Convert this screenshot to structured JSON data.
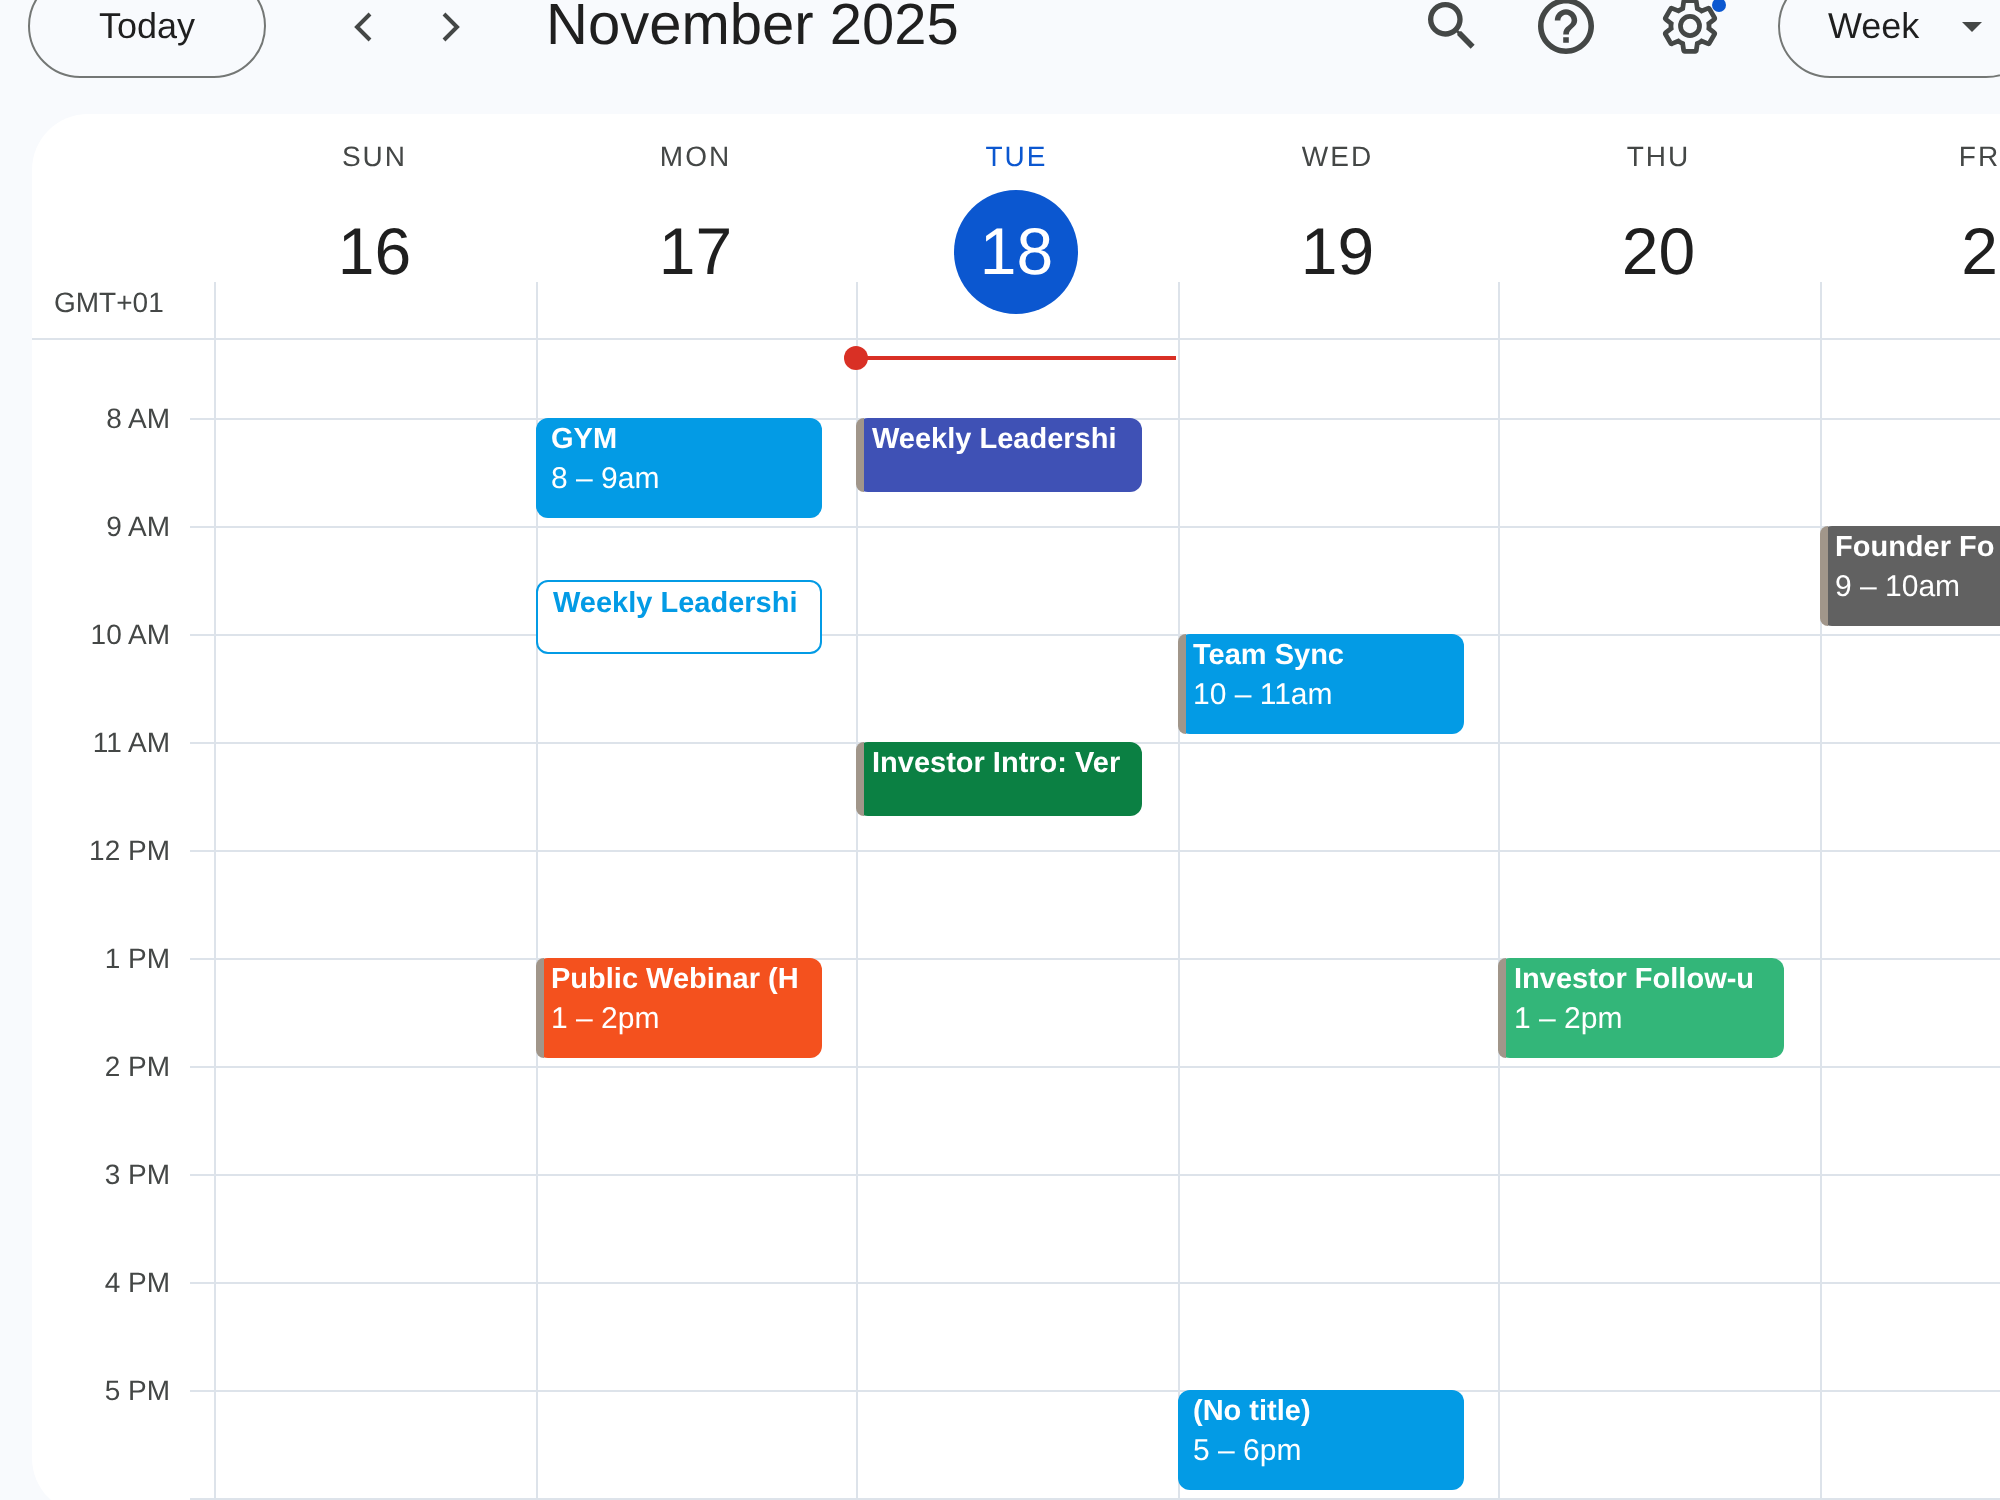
{
  "toolbar": {
    "today_button": "Today",
    "title": "November 2025",
    "view": "Week",
    "settings_notification": true
  },
  "timezone": "GMT+01",
  "hours": [
    "8 AM",
    "9 AM",
    "10 AM",
    "11 AM",
    "12 PM",
    "1 PM",
    "2 PM",
    "3 PM",
    "4 PM",
    "5 PM"
  ],
  "days": [
    {
      "weekday": "SUN",
      "date": "16",
      "today": false
    },
    {
      "weekday": "MON",
      "date": "17",
      "today": false,
      "events": [
        {
          "title": "GYM",
          "time": "8 – 9am",
          "color": "#039be5",
          "kind": "filled",
          "stripe": false
        },
        {
          "title": "Weekly Leadershi",
          "color": "#039be5",
          "kind": "outlined",
          "stripe": false
        },
        {
          "title": "Public Webinar (H",
          "time": "1 – 2pm",
          "color": "#f4511e",
          "kind": "filled",
          "stripe": true
        }
      ]
    },
    {
      "weekday": "TUE",
      "date": "18",
      "today": true,
      "events": [
        {
          "title": "Weekly Leadershi",
          "color": "#3f51b5",
          "kind": "filled",
          "stripe": true
        },
        {
          "title": "Investor Intro: Ver",
          "color": "#0b8043",
          "kind": "filled",
          "stripe": true
        }
      ]
    },
    {
      "weekday": "WED",
      "date": "19",
      "today": false,
      "events": [
        {
          "title": "Team Sync",
          "time": "10 – 11am",
          "color": "#039be5",
          "kind": "filled",
          "stripe": true
        },
        {
          "title": "(No title)",
          "time": "5 – 6pm",
          "color": "#039be5",
          "kind": "filled",
          "stripe": false
        }
      ]
    },
    {
      "weekday": "THU",
      "date": "20",
      "today": false,
      "events": [
        {
          "title": "Investor Follow-u",
          "time": "1 – 2pm",
          "color": "#33b679",
          "kind": "filled",
          "stripe": true
        }
      ]
    },
    {
      "weekday": "FR",
      "date": "2",
      "today": false,
      "events": [
        {
          "title": "Founder Fo",
          "time": "9 – 10am",
          "color": "#616161",
          "kind": "filled",
          "stripe": true
        }
      ]
    }
  ]
}
